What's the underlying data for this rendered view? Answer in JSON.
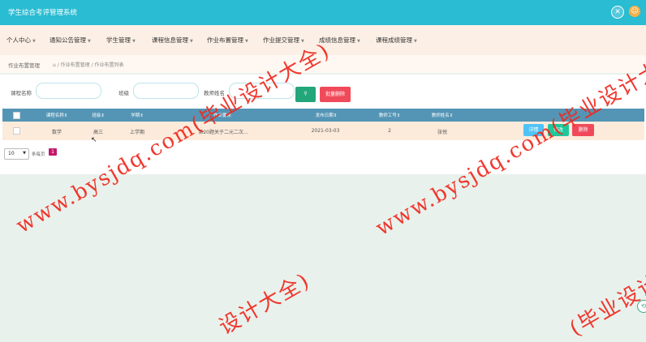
{
  "app": {
    "title": "学生综合考评管理系统",
    "close_icon_glyph": "✕",
    "user_icon_glyph": "☺"
  },
  "nav": {
    "items": [
      {
        "label": "个人中心"
      },
      {
        "label": "通知公告管理"
      },
      {
        "label": "学生管理"
      },
      {
        "label": "课程信息管理"
      },
      {
        "label": "作业布置管理"
      },
      {
        "label": "作业提交管理"
      },
      {
        "label": "成绩信息管理"
      },
      {
        "label": "课程成绩管理"
      }
    ],
    "caret": "▼"
  },
  "breadcrumb": {
    "title": "作业布置管理",
    "home_icon": "⌂",
    "path": "/ 作业布置管理 / 作业布置列表"
  },
  "search": {
    "course_label": "课程名称",
    "class_label": "班级",
    "teacher_label": "教师姓名",
    "search_button": "",
    "batch_delete_button": "批量删除"
  },
  "table": {
    "headers": [
      "课程名称",
      "班级",
      "学期",
      "作业要求",
      "发布日期",
      "教师工号",
      "教师姓名"
    ],
    "sort_icon": "⇕",
    "rows": [
      {
        "course": "数学",
        "class": "高三",
        "term": "上学期",
        "requirement": "第20题关于二元二次...",
        "date": "2021-03-03",
        "teacher_id": "2",
        "teacher_name": "张悦",
        "detail_label": "详情",
        "edit_label": "修改",
        "delete_label": "删除"
      }
    ]
  },
  "pager": {
    "page_size": "10",
    "per_page_label": "条每页",
    "current_page": "1"
  },
  "watermarks": {
    "text1": "www.bysjdq.com(毕业设计大全)",
    "text2": "www.bysjdq.com(毕业设计大全)",
    "text3": "设计大全)",
    "text4": "(毕业设计大全)"
  },
  "colors": {
    "topbar": "#29bcd2",
    "navbar": "#fcf0e6",
    "table_header": "#5495b5",
    "row": "#fcebdb",
    "search_button": "#22a67a",
    "batch_delete": "#f04a5a",
    "detail_button": "#4fc3f7",
    "edit_button": "#1ec89a",
    "delete_button": "#f04a5a",
    "watermark": "#f0281e",
    "page_badge": "#c2186d"
  }
}
